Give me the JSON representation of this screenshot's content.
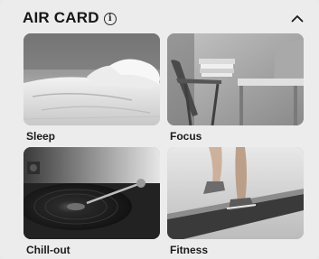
{
  "header": {
    "title": "AIR CARD",
    "info_icon": "info-circle-icon",
    "collapse_icon": "chevron-up-icon"
  },
  "cards": [
    {
      "label": "Sleep",
      "image": "bedroom-photo"
    },
    {
      "label": "Focus",
      "image": "desk-photo"
    },
    {
      "label": "Chill-out",
      "image": "turntable-photo"
    },
    {
      "label": "Fitness",
      "image": "treadmill-photo"
    }
  ],
  "colors": {
    "panel_background": "#ececec",
    "text": "#161616"
  }
}
